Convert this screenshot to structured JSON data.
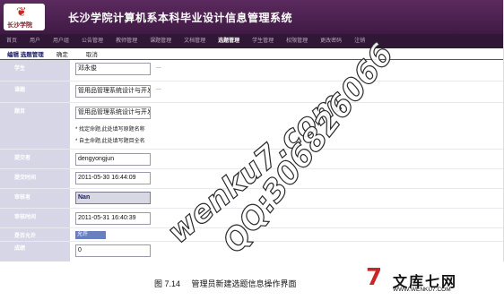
{
  "app": {
    "title": "长沙学院计算机系本科毕业设计信息管理系统",
    "logo_text": "长沙学院"
  },
  "nav": {
    "items": [
      "首页",
      "用户",
      "用户组",
      "公告管理",
      "教师管理",
      "课题管理",
      "文档管理",
      "选题管理",
      "学生管理",
      "权限管理",
      "更改密码",
      "注销"
    ],
    "active": "选题管理"
  },
  "toolbar": {
    "title": "编辑 选题管理",
    "confirm_label": "确定",
    "cancel_label": "取消"
  },
  "form": {
    "student": {
      "label": "学生",
      "value": "邓永俊",
      "more": "..."
    },
    "topic": {
      "label": "课题",
      "value": "管用品管理系统设计与开发",
      "more": "..."
    },
    "subject": {
      "label": "题目",
      "value": "管用品管理系统设计与开发",
      "note1": "* 找定命题,此处填写原题名称",
      "note2": "* 自主命题,此处填写题目全名"
    },
    "submitter": {
      "label": "提交者",
      "value": "dengyongjun"
    },
    "submit_time": {
      "label": "提交时间",
      "value": "2011-05-30 16:44:09"
    },
    "reviewer": {
      "label": "审核者",
      "value": "Nan"
    },
    "review_time": {
      "label": "审核时间",
      "value": "2011-05-31 16:40:39"
    },
    "allowed": {
      "label": "是否允许",
      "value": "允许"
    },
    "score": {
      "label": "成绩",
      "value": "0"
    }
  },
  "watermark": {
    "line1": "wenku7.com",
    "line2": "QQ:306826066"
  },
  "caption": {
    "figure": "图 7.14",
    "text": "管理员新建选题信息操作界面"
  },
  "brand": {
    "mark": "7",
    "name": "文库七网",
    "url": "WWW.WENKU7.COM"
  }
}
